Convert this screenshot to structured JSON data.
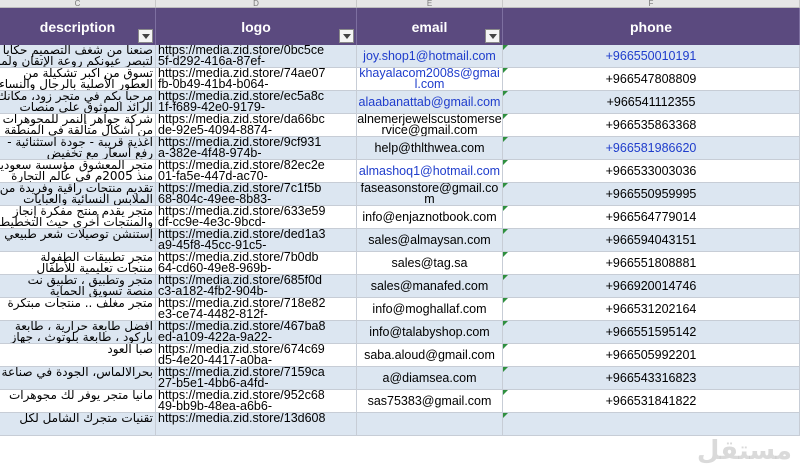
{
  "columns": {
    "description": "description",
    "logo": "logo",
    "email": "email",
    "phone": "phone"
  },
  "col_letters": [
    "C",
    "D",
    "E",
    "F"
  ],
  "rows": [
    {
      "desc1": "صنعنا من شغف التصميم حكايا",
      "desc2": "لتبصر عيونكم روعة الإتقان ولمسة",
      "logo1": "https://media.zid.store/0bc5ce",
      "logo2": "5f-d292-416a-87ef-",
      "email": "joy.shop1@hotmail.com",
      "email_link": true,
      "phone": "+966550010191",
      "phone_link": true
    },
    {
      "desc1": "تسوق من أكبر تشكيلة من",
      "desc2": "العطور الأصلية بالرجال والنساء",
      "logo1": "https://media.zid.store/74ae07",
      "logo2": "fb-0b49-41b4-b064-",
      "email": "khayalacom2008s@gmail.com",
      "email_link": true,
      "phone": "+966547808809",
      "phone_link": false
    },
    {
      "desc1": "مرحبا بكم في متجر زود، مكانك",
      "desc2": "الرائد الموثوق على منصات",
      "logo1": "https://media.zid.store/ec5a8c",
      "logo2": "1f-f689-42e0-9179-",
      "email": "alaabanattab@gmail.com",
      "email_link": true,
      "phone": "+966541112355",
      "phone_link": false
    },
    {
      "desc1": "شركة جواهر النمر للمجوهرات",
      "desc2": "من أشكال متألقة في المنطقة",
      "logo1": "https://media.zid.store/da66bc",
      "logo2": "de-92e5-4094-8874-",
      "email": "alnemerjewelscustomerservice@gmail.com",
      "email_link": false,
      "phone": "+966535863368",
      "phone_link": false
    },
    {
      "desc1": "اغذية قريبة - جودة استثنائية -",
      "desc2": "رفع أسعار مع تخفيض",
      "logo1": "https://media.zid.store/9cf931",
      "logo2": "a-382e-4f48-974b-",
      "email": "help@thlthwea.com",
      "email_link": false,
      "phone": "+966581986620",
      "phone_link": true
    },
    {
      "desc1": "متجر المعشوق مؤسسة سعودية",
      "desc2": "منذ 2005م في عالم التجارة",
      "logo1": "https://media.zid.store/82ec2e",
      "logo2": "01-fa5e-447d-ac70-",
      "email": "almashoq1@hotmail.com",
      "email_link": true,
      "phone": "+966533003036",
      "phone_link": false
    },
    {
      "desc1": "تقديم منتجات راقية وفريدة من",
      "desc2": "الملابس النسائية والعبايات",
      "logo1": "https://media.zid.store/7c1f5b",
      "logo2": "68-804c-49ee-8b83-",
      "email": "faseasonstore@gmail.com",
      "email_link": false,
      "phone": "+966550959995",
      "phone_link": false
    },
    {
      "desc1": "متجر يقدم منتج مفكرة إنجاز",
      "desc2": "والمنتجات أخرى حيث التخطيط",
      "logo1": "https://media.zid.store/633e59",
      "logo2": "df-cc9e-4e3c-9bcd-",
      "email": "info@enjaznotbook.com",
      "email_link": false,
      "phone": "+966564779014",
      "phone_link": false
    },
    {
      "desc1": "إستنشن توصيلات شعر طبيعي",
      "desc2": "",
      "logo1": "https://media.zid.store/ded1a3",
      "logo2": "a9-45f8-45cc-91c5-",
      "email": "sales@almaysan.com",
      "email_link": false,
      "phone": "+966594043151",
      "phone_link": false
    },
    {
      "desc1": "متجر تطبيقات الطفولة",
      "desc2": "منتجات تعليمية للأطفال",
      "logo1": "https://media.zid.store/7b0db",
      "logo2": "64-cd60-49e8-969b-",
      "email": "sales@tag.sa",
      "email_link": false,
      "phone": "+966551808881",
      "phone_link": false
    },
    {
      "desc1": "متجر وتطبيق ، تطبيق نت",
      "desc2": "منصة تسويق الحماية",
      "logo1": "https://media.zid.store/685f0d",
      "logo2": "c3-a182-4fb2-904b-",
      "email": "sales@manafed.com",
      "email_link": false,
      "phone": "+966920014746",
      "phone_link": false
    },
    {
      "desc1": "متجر مغلف .. منتجات مبتكرة",
      "desc2": "",
      "logo1": "https://media.zid.store/718e82",
      "logo2": "e3-ce74-4482-812f-",
      "email": "info@moghallaf.com",
      "email_link": false,
      "phone": "+966531202164",
      "phone_link": false
    },
    {
      "desc1": "أفضل طابعة حرارية ، طابعة",
      "desc2": "باركود ، طابعة بلوتوث ، جهاز",
      "logo1": "https://media.zid.store/467ba8",
      "logo2": "ed-a109-422a-9a22-",
      "email": "info@talabyshop.com",
      "email_link": false,
      "phone": "+966551595142",
      "phone_link": false
    },
    {
      "desc1": "صبا العود",
      "desc2": "",
      "logo1": "https://media.zid.store/674c69",
      "logo2": "d5-4e20-4417-a0ba-",
      "email": "saba.aloud@gmail.com",
      "email_link": false,
      "phone": "+966505992201",
      "phone_link": false
    },
    {
      "desc1": "بحرالالماس، الجودة في صناعة",
      "desc2": "",
      "logo1": "https://media.zid.store/7159ca",
      "logo2": "27-b5e1-4bb6-a4fd-",
      "email": "a@diamsea.com",
      "email_link": false,
      "phone": "+966543316823",
      "phone_link": false
    },
    {
      "desc1": "مانيا متجر يوفر لك مجوهرات",
      "desc2": "",
      "logo1": "https://media.zid.store/952c68",
      "logo2": "49-bb9b-48ea-a6b6-",
      "email": "sas75383@gmail.com",
      "email_link": false,
      "phone": "+966531841822",
      "phone_link": false
    },
    {
      "desc1": "تقنيات متجرك الشامل لكل",
      "desc2": "",
      "logo1": "https://media.zid.store/13d608",
      "logo2": "",
      "email": "",
      "email_link": false,
      "phone": "",
      "phone_link": false
    }
  ]
}
